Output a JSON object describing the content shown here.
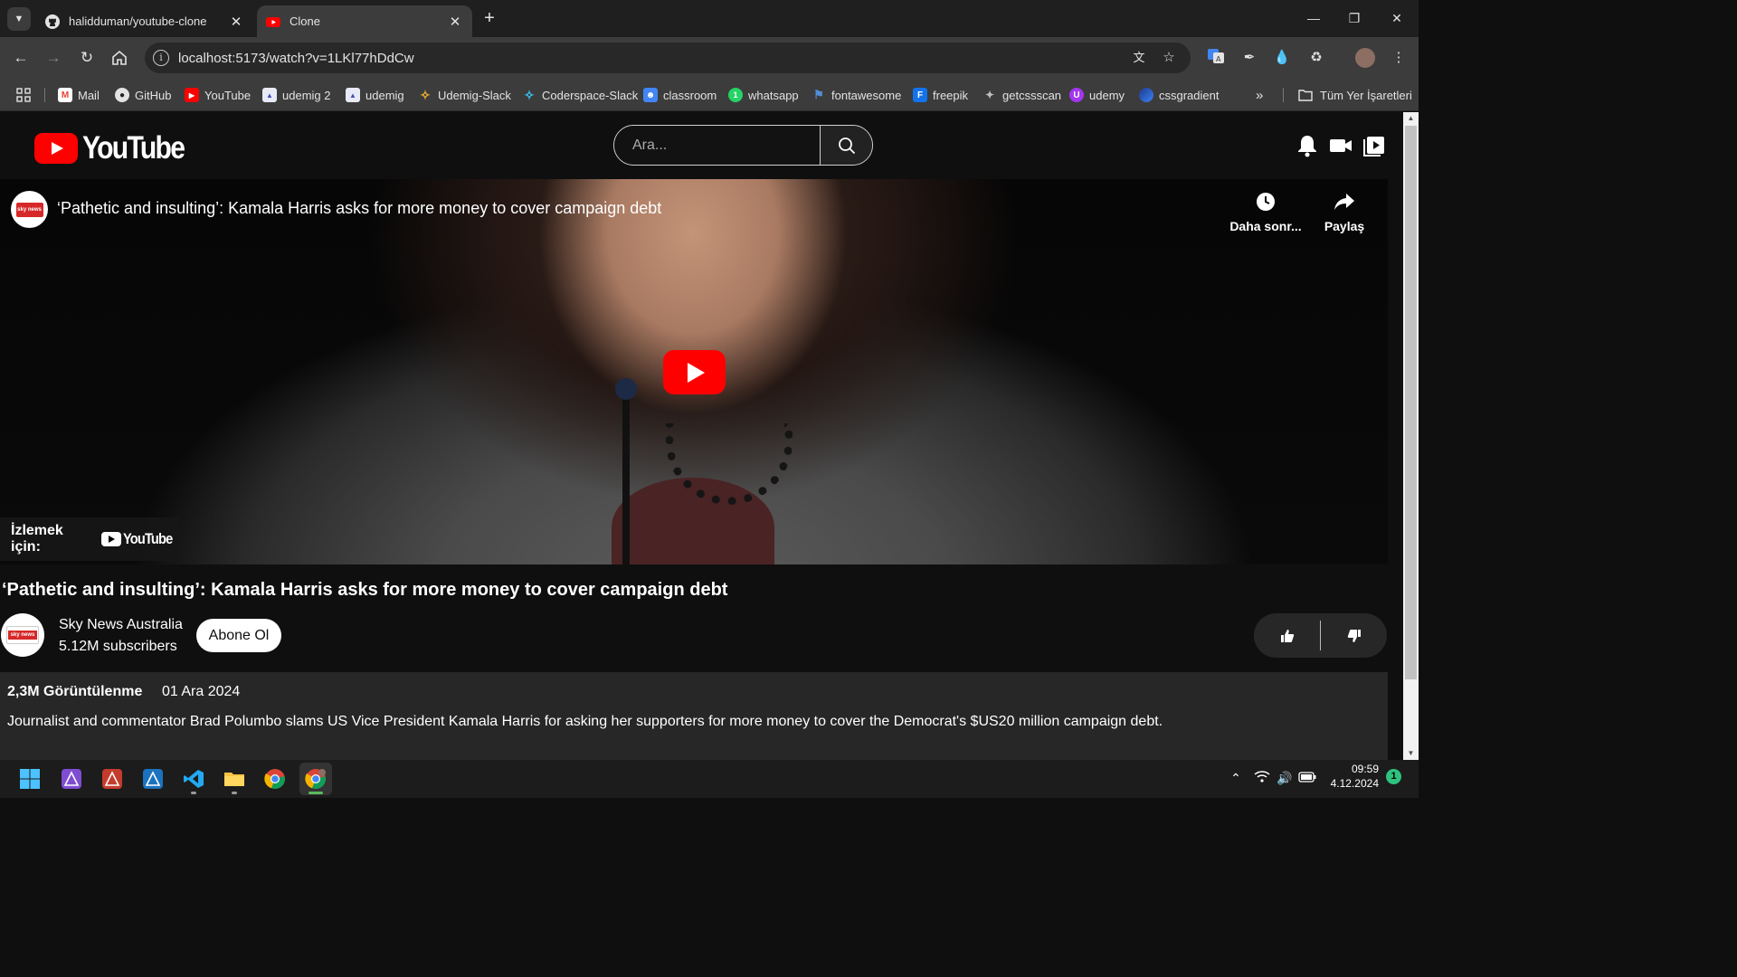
{
  "browser": {
    "tabs": [
      {
        "title": "halidduman/youtube-clone",
        "active": false,
        "favicon": "github-icon"
      },
      {
        "title": "Clone",
        "active": true,
        "favicon": "youtube-icon"
      }
    ],
    "url": "localhost:5173/watch?v=1LKl77hDdCw",
    "bookmarks": [
      {
        "label": "Mail",
        "icon": "gmail-icon"
      },
      {
        "label": "GitHub",
        "icon": "github-icon"
      },
      {
        "label": "YouTube",
        "icon": "youtube-icon"
      },
      {
        "label": "udemig 2",
        "icon": "udemig-icon"
      },
      {
        "label": "udemig",
        "icon": "udemig-icon"
      },
      {
        "label": "Udemig-Slack",
        "icon": "slack-icon"
      },
      {
        "label": "Coderspace-Slack",
        "icon": "slack-icon"
      },
      {
        "label": "classroom",
        "icon": "classroom-icon"
      },
      {
        "label": "whatsapp",
        "icon": "whatsapp-icon"
      },
      {
        "label": "fontawesome",
        "icon": "fontawesome-icon"
      },
      {
        "label": "freepik",
        "icon": "freepik-icon"
      },
      {
        "label": "getcssscan",
        "icon": "getcssscan-icon"
      },
      {
        "label": "udemy",
        "icon": "udemy-icon"
      },
      {
        "label": "cssgradient",
        "icon": "cssgradient-icon"
      }
    ],
    "all_bookmarks": "Tüm Yer İşaretleri"
  },
  "app": {
    "logo_text": "YouTube",
    "search_placeholder": "Ara..."
  },
  "player": {
    "title": "‘Pathetic and insulting’: Kamala Harris asks for more money to cover campaign debt",
    "channel_badge": "sky news",
    "watch_later": "Daha sonr...",
    "share": "Paylaş",
    "watch_on": "İzlemek için:",
    "watch_on_brand": "YouTube"
  },
  "video": {
    "title": "‘Pathetic and insulting’: Kamala Harris asks for more money to cover campaign debt",
    "channel_name": "Sky News Australia",
    "subscribers": "5.12M subscribers",
    "subscribe_label": "Abone Ol",
    "views": "2,3M Görüntülenme",
    "date": "01 Ara 2024",
    "description": "Journalist and commentator Brad Polumbo slams US Vice President Kamala Harris for asking her supporters for more money to cover the Democrat's $US20 million campaign debt."
  },
  "taskbar": {
    "time": "09:59",
    "date": "4.12.2024",
    "notifications": "1"
  },
  "colors": {
    "accent_red": "#ff0000",
    "page_bg": "#0f0f0f",
    "panel_bg": "#272727"
  }
}
